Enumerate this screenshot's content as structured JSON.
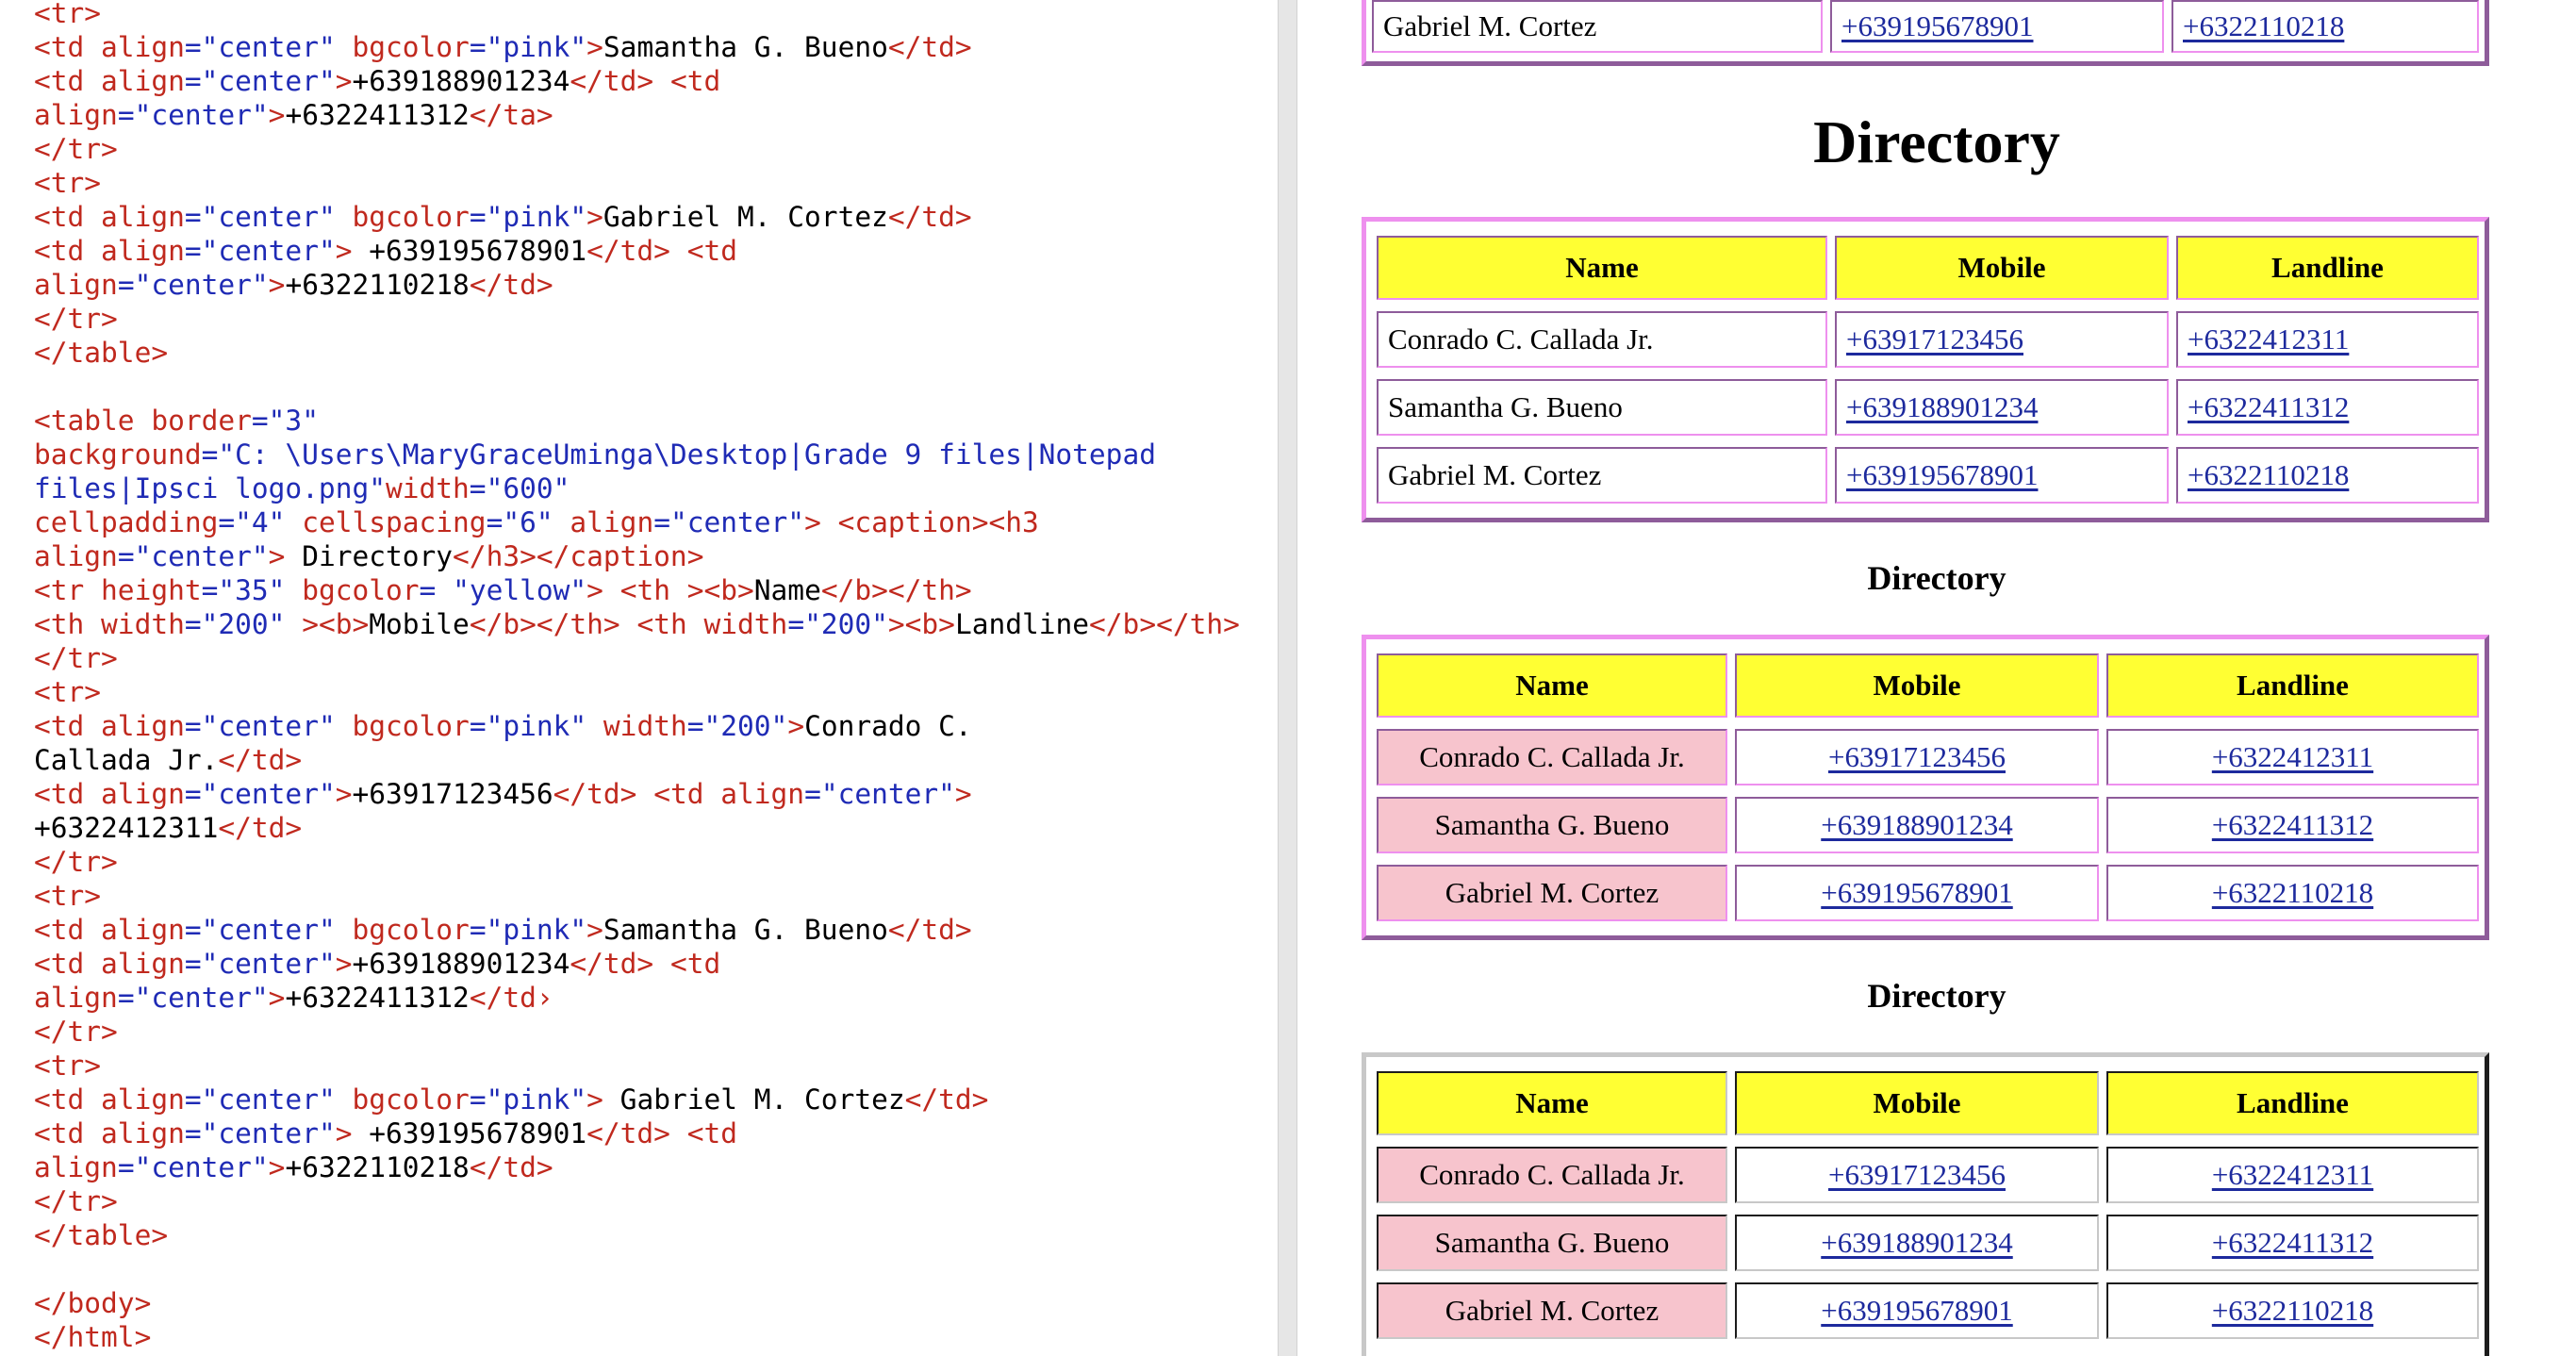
{
  "editor": {
    "lines": [
      [
        [
          "tag",
          "<tr>"
        ]
      ],
      [
        [
          "tag",
          "<td "
        ],
        [
          "attr",
          "align"
        ],
        [
          "punct",
          "="
        ],
        [
          "val",
          "\"center\""
        ],
        [
          "attr",
          " bgcolor"
        ],
        [
          "punct",
          "="
        ],
        [
          "val",
          "\"pink\""
        ],
        [
          "tag",
          ">"
        ],
        [
          "text",
          "Samantha G. Bueno"
        ],
        [
          "tag",
          "</td>"
        ]
      ],
      [
        [
          "tag",
          "<td "
        ],
        [
          "attr",
          "align"
        ],
        [
          "punct",
          "="
        ],
        [
          "val",
          "\"center\""
        ],
        [
          "tag",
          ">"
        ],
        [
          "text",
          "+639188901234"
        ],
        [
          "tag",
          "</td>"
        ],
        [
          "text",
          " "
        ],
        [
          "tag",
          "<td"
        ]
      ],
      [
        [
          "attr",
          "align"
        ],
        [
          "punct",
          "="
        ],
        [
          "val",
          "\"center\""
        ],
        [
          "tag",
          ">"
        ],
        [
          "text",
          "+6322411312"
        ],
        [
          "tag",
          "</ta>"
        ]
      ],
      [
        [
          "tag",
          "</tr>"
        ]
      ],
      [
        [
          "tag",
          "<tr>"
        ]
      ],
      [
        [
          "tag",
          "<td "
        ],
        [
          "attr",
          "align"
        ],
        [
          "punct",
          "="
        ],
        [
          "val",
          "\"center\""
        ],
        [
          "attr",
          " bgcolor"
        ],
        [
          "punct",
          "="
        ],
        [
          "val",
          "\"pink\""
        ],
        [
          "tag",
          ">"
        ],
        [
          "text",
          "Gabriel M. Cortez"
        ],
        [
          "tag",
          "</td>"
        ]
      ],
      [
        [
          "tag",
          "<td "
        ],
        [
          "attr",
          "align"
        ],
        [
          "punct",
          "="
        ],
        [
          "val",
          "\"center\""
        ],
        [
          "tag",
          ">"
        ],
        [
          "text",
          " +639195678901"
        ],
        [
          "tag",
          "</td>"
        ],
        [
          "text",
          " "
        ],
        [
          "tag",
          "<td"
        ]
      ],
      [
        [
          "attr",
          "align"
        ],
        [
          "punct",
          "="
        ],
        [
          "val",
          "\"center\""
        ],
        [
          "tag",
          ">"
        ],
        [
          "text",
          "+6322110218"
        ],
        [
          "tag",
          "</td>"
        ]
      ],
      [
        [
          "tag",
          "</tr>"
        ]
      ],
      [
        [
          "tag",
          "</table>"
        ]
      ],
      [],
      [
        [
          "tag",
          "<table "
        ],
        [
          "attr",
          "border"
        ],
        [
          "punct",
          "="
        ],
        [
          "val",
          "\"3\""
        ]
      ],
      [
        [
          "attr",
          "background"
        ],
        [
          "punct",
          "="
        ],
        [
          "val",
          "\"C: \\Users\\MaryGraceUminga\\Desktop|Grade 9 files|Notepad"
        ]
      ],
      [
        [
          "val",
          "files|Ipsci logo.png\""
        ],
        [
          "attr",
          "width"
        ],
        [
          "punct",
          "="
        ],
        [
          "val",
          "\"600\""
        ]
      ],
      [
        [
          "attr",
          "cellpadding"
        ],
        [
          "punct",
          "="
        ],
        [
          "val",
          "\"4\""
        ],
        [
          "attr",
          " cellspacing"
        ],
        [
          "punct",
          "="
        ],
        [
          "val",
          "\"6\""
        ],
        [
          "attr",
          " align"
        ],
        [
          "punct",
          "="
        ],
        [
          "val",
          "\"center\""
        ],
        [
          "tag",
          ">"
        ],
        [
          "text",
          " "
        ],
        [
          "tag",
          "<caption><h3"
        ]
      ],
      [
        [
          "attr",
          "align"
        ],
        [
          "punct",
          "="
        ],
        [
          "val",
          "\"center\""
        ],
        [
          "tag",
          ">"
        ],
        [
          "text",
          " Directory"
        ],
        [
          "tag",
          "</h3></caption>"
        ]
      ],
      [
        [
          "tag",
          "<tr "
        ],
        [
          "attr",
          "height"
        ],
        [
          "punct",
          "="
        ],
        [
          "val",
          "\"35\""
        ],
        [
          "attr",
          " bgcolor"
        ],
        [
          "punct",
          "= "
        ],
        [
          "val",
          "\"yellow\""
        ],
        [
          "tag",
          ">"
        ],
        [
          "text",
          " "
        ],
        [
          "tag",
          "<th "
        ],
        [
          "tag",
          "><b>"
        ],
        [
          "text",
          "Name"
        ],
        [
          "tag",
          "</b></th>"
        ]
      ],
      [
        [
          "tag",
          "<th "
        ],
        [
          "attr",
          "width"
        ],
        [
          "punct",
          "="
        ],
        [
          "val",
          "\"200\""
        ],
        [
          "text",
          " "
        ],
        [
          "tag",
          "><b>"
        ],
        [
          "text",
          "Mobile"
        ],
        [
          "tag",
          "</b></th>"
        ],
        [
          "text",
          " "
        ],
        [
          "tag",
          "<th "
        ],
        [
          "attr",
          "width"
        ],
        [
          "punct",
          "="
        ],
        [
          "val",
          "\"200\""
        ],
        [
          "tag",
          "><b>"
        ],
        [
          "text",
          "Landline"
        ],
        [
          "tag",
          "</b></th>"
        ]
      ],
      [
        [
          "tag",
          "</tr>"
        ]
      ],
      [
        [
          "tag",
          "<tr>"
        ]
      ],
      [
        [
          "tag",
          "<td "
        ],
        [
          "attr",
          "align"
        ],
        [
          "punct",
          "="
        ],
        [
          "val",
          "\"center\""
        ],
        [
          "attr",
          " bgcolor"
        ],
        [
          "punct",
          "="
        ],
        [
          "val",
          "\"pink\""
        ],
        [
          "attr",
          " width"
        ],
        [
          "punct",
          "="
        ],
        [
          "val",
          "\"200\""
        ],
        [
          "tag",
          ">"
        ],
        [
          "text",
          "Conrado C."
        ]
      ],
      [
        [
          "text",
          "Callada Jr."
        ],
        [
          "tag",
          "</td>"
        ]
      ],
      [
        [
          "tag",
          "<td "
        ],
        [
          "attr",
          "align"
        ],
        [
          "punct",
          "="
        ],
        [
          "val",
          "\"center\""
        ],
        [
          "tag",
          ">"
        ],
        [
          "text",
          "+63917123456"
        ],
        [
          "tag",
          "</td>"
        ],
        [
          "text",
          " "
        ],
        [
          "tag",
          "<td "
        ],
        [
          "attr",
          "align"
        ],
        [
          "punct",
          "="
        ],
        [
          "val",
          "\"center\""
        ],
        [
          "tag",
          ">"
        ]
      ],
      [
        [
          "text",
          "+6322412311"
        ],
        [
          "tag",
          "</td>"
        ]
      ],
      [
        [
          "tag",
          "</tr>"
        ]
      ],
      [
        [
          "tag",
          "<tr>"
        ]
      ],
      [
        [
          "tag",
          "<td "
        ],
        [
          "attr",
          "align"
        ],
        [
          "punct",
          "="
        ],
        [
          "val",
          "\"center\""
        ],
        [
          "attr",
          " bgcolor"
        ],
        [
          "punct",
          "="
        ],
        [
          "val",
          "\"pink\""
        ],
        [
          "tag",
          ">"
        ],
        [
          "text",
          "Samantha G. Bueno"
        ],
        [
          "tag",
          "</td>"
        ]
      ],
      [
        [
          "tag",
          "<td "
        ],
        [
          "attr",
          "align"
        ],
        [
          "punct",
          "="
        ],
        [
          "val",
          "\"center\""
        ],
        [
          "tag",
          ">"
        ],
        [
          "text",
          "+639188901234"
        ],
        [
          "tag",
          "</td>"
        ],
        [
          "text",
          " "
        ],
        [
          "tag",
          "<td"
        ]
      ],
      [
        [
          "attr",
          "align"
        ],
        [
          "punct",
          "="
        ],
        [
          "val",
          "\"center\""
        ],
        [
          "tag",
          ">"
        ],
        [
          "text",
          "+6322411312"
        ],
        [
          "tag",
          "</td›"
        ]
      ],
      [
        [
          "tag",
          "</tr>"
        ]
      ],
      [
        [
          "tag",
          "<tr>"
        ]
      ],
      [
        [
          "tag",
          "<td "
        ],
        [
          "attr",
          "align"
        ],
        [
          "punct",
          "="
        ],
        [
          "val",
          "\"center\""
        ],
        [
          "attr",
          " bgcolor"
        ],
        [
          "punct",
          "="
        ],
        [
          "val",
          "\"pink\""
        ],
        [
          "tag",
          ">"
        ],
        [
          "text",
          " Gabriel M. Cortez"
        ],
        [
          "tag",
          "</td>"
        ]
      ],
      [
        [
          "tag",
          "<td "
        ],
        [
          "attr",
          "align"
        ],
        [
          "punct",
          "="
        ],
        [
          "val",
          "\"center\""
        ],
        [
          "tag",
          ">"
        ],
        [
          "text",
          " +639195678901"
        ],
        [
          "tag",
          "</td>"
        ],
        [
          "text",
          " "
        ],
        [
          "tag",
          "<td"
        ]
      ],
      [
        [
          "attr",
          "align"
        ],
        [
          "punct",
          "="
        ],
        [
          "val",
          "\"center\""
        ],
        [
          "tag",
          ">"
        ],
        [
          "text",
          "+6322110218"
        ],
        [
          "tag",
          "</td>"
        ]
      ],
      [
        [
          "tag",
          "</tr>"
        ]
      ],
      [
        [
          "tag",
          "</table>"
        ]
      ],
      [],
      [
        [
          "tag",
          "</body>"
        ]
      ],
      [
        [
          "tag",
          "</html>"
        ]
      ]
    ]
  },
  "preview": {
    "top_partial_row": {
      "name": "Gabriel M. Cortez",
      "mobile": "+639195678901",
      "landline": "+6322110218"
    },
    "big_title": "Directory",
    "caption_2": "Directory",
    "caption_3": "Directory",
    "headers": {
      "name": "Name",
      "mobile": "Mobile",
      "landline": "Landline"
    },
    "rows": [
      {
        "name": "Conrado C. Callada Jr.",
        "mobile": "+63917123456",
        "landline": "+6322412311"
      },
      {
        "name": "Samantha G. Bueno",
        "mobile": "+639188901234",
        "landline": "+6322411312"
      },
      {
        "name": "Gabriel M. Cortez",
        "mobile": "+639195678901",
        "landline": "+6322110218"
      }
    ],
    "colors": {
      "header_bg": "#ffff33",
      "pink_cell": "#f7c4cd",
      "link": "#1d2a9d",
      "border_light": "#ee90ee",
      "border_dark": "#8e5c9a"
    }
  }
}
